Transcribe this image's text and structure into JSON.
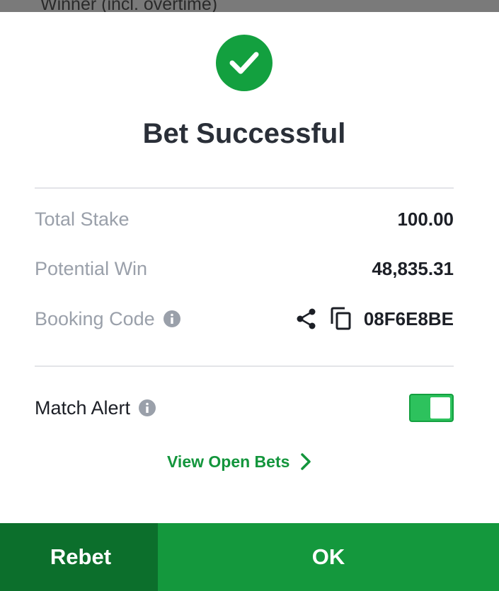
{
  "backdrop": {
    "text": "Winner (incl. overtime)"
  },
  "dialog": {
    "title": "Bet Successful",
    "rows": {
      "total_stake": {
        "label": "Total Stake",
        "value": "100.00"
      },
      "potential_win": {
        "label": "Potential Win",
        "value": "48,835.31"
      },
      "booking_code": {
        "label": "Booking Code",
        "value": "08F6E8BE"
      }
    },
    "match_alert": {
      "label": "Match Alert",
      "enabled": true
    },
    "view_open_bets": "View Open Bets",
    "buttons": {
      "rebet": "Rebet",
      "ok": "OK"
    },
    "colors": {
      "accent": "#13a03f",
      "rebet_bg": "#0c6f2c",
      "ok_bg": "#14983d",
      "toggle_on": "#2dc25d"
    },
    "icons": [
      "check-circle-icon",
      "info-icon",
      "share-icon",
      "copy-icon",
      "chevron-right-icon"
    ]
  }
}
